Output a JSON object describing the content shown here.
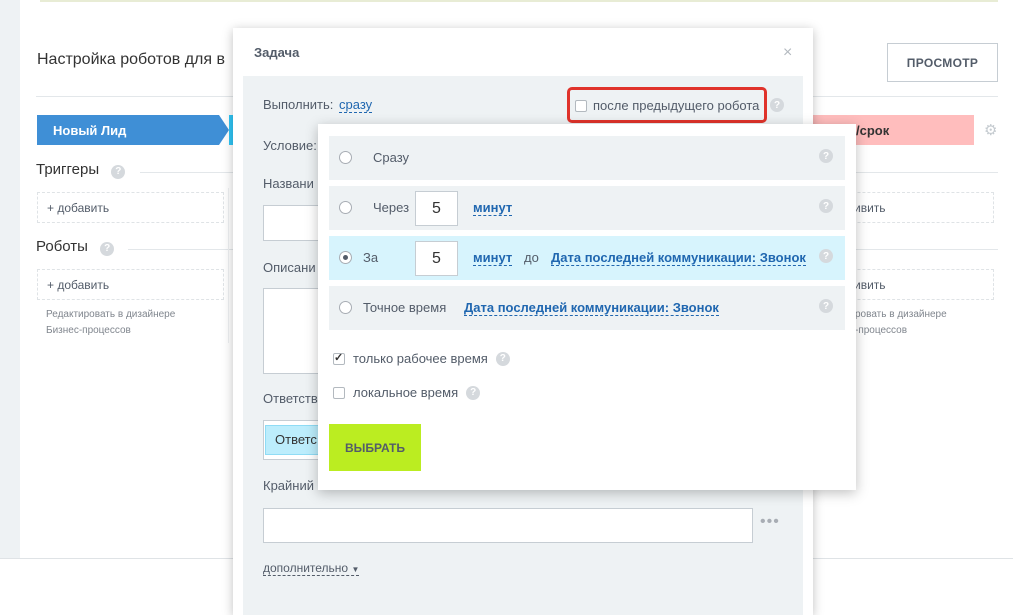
{
  "page": {
    "title": "Настройка роботов для в",
    "preview_button": "ПРОСМОТР",
    "stages": {
      "lead": "Новый Лид",
      "pink": "в/срок"
    },
    "triggers": {
      "title": "Триггеры",
      "add_left": "+ добавить",
      "add_right": "ивить"
    },
    "robots": {
      "title": "Роботы",
      "add_left": "+ добавить",
      "add_right": "ивить",
      "edit_note_line1": "Редактировать в дизайнере",
      "edit_note_line2": "Бизнес-процессов",
      "edit_note_right_line1": "ровать в дизайнере",
      "edit_note_right_line2": "-процессов"
    }
  },
  "dialog": {
    "title": "Задача",
    "close": "×",
    "execute_label": "Выполнить:",
    "execute_value": "сразу",
    "after_prev_label": "после предыдущего робота",
    "condition_label": "Условие:",
    "name_label": "Названи",
    "description_label": "Описани",
    "responsible_label": "Ответств",
    "responsible_value": "Ответс",
    "deadline_label": "Крайний с",
    "dots": "•••",
    "more_link": "дополнительно"
  },
  "popup": {
    "options": [
      {
        "label": "Сразу"
      },
      {
        "label": "Через",
        "number": "5",
        "unit": "минут"
      },
      {
        "label": "За",
        "number": "5",
        "unit": "минут",
        "connector": "до",
        "target": "Дата последней коммуникации: Звонок"
      },
      {
        "label": "Точное время",
        "target": "Дата последней коммуникации: Звонок"
      }
    ],
    "work_time_label": "только рабочее время",
    "local_time_label": "локальное время",
    "choose_button": "ВЫБРАТЬ"
  },
  "icons": {
    "help": "?",
    "gear": "⚙"
  }
}
